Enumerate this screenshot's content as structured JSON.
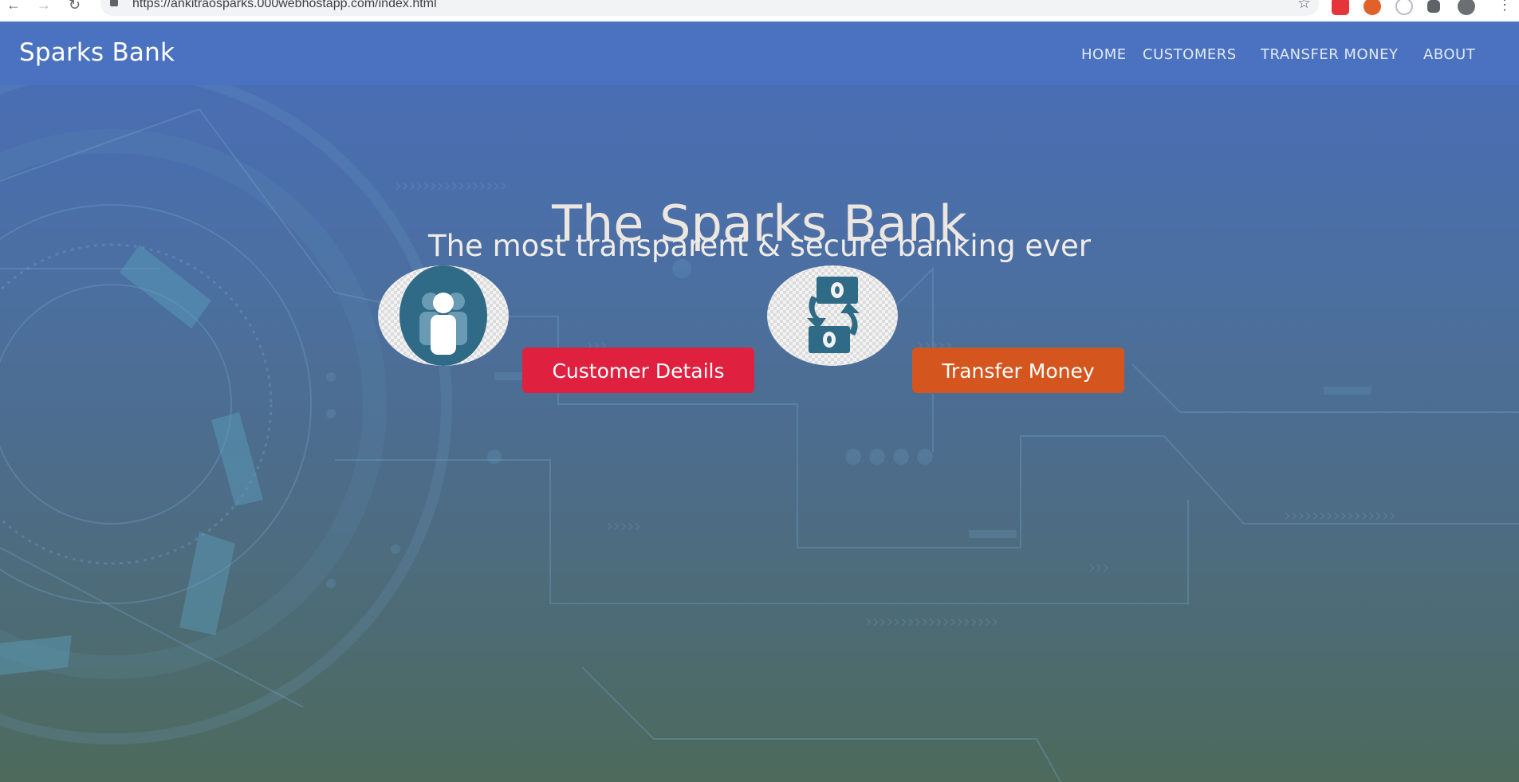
{
  "browser": {
    "url": "https://ankitraosparks.000webhostapp.com/index.html"
  },
  "navbar": {
    "brand": "Sparks Bank",
    "links": [
      "HOME",
      "CUSTOMERS",
      "TRANSFER MONEY",
      "ABOUT"
    ]
  },
  "hero": {
    "title": "The Sparks Bank",
    "subtitle": "The most transparent & secure banking ever",
    "customer_button": "Customer Details",
    "transfer_button": "Transfer Money"
  },
  "icons": {
    "customers": "customers-icon",
    "transfer": "money-transfer-icon"
  },
  "colors": {
    "navbar": "#4a72c0",
    "customer_button": "#e0203f",
    "transfer_button": "#d4561e",
    "icon_teal": "#2f6a86"
  }
}
